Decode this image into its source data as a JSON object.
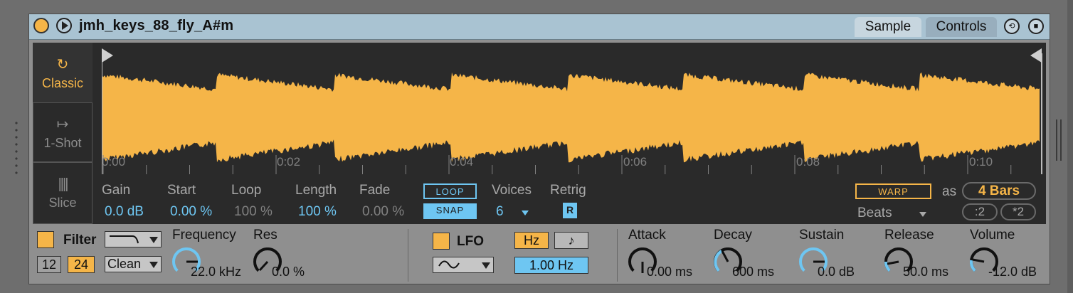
{
  "device": {
    "title": "jmh_keys_88_fly_A#m",
    "tabs": [
      "Sample",
      "Controls"
    ]
  },
  "modes": [
    {
      "label": "Classic",
      "icon": "loop-icon",
      "glyph": "↻"
    },
    {
      "label": "1-Shot",
      "icon": "one-shot-icon",
      "glyph": "↦"
    },
    {
      "label": "Slice",
      "icon": "slice-icon",
      "glyph": "||||"
    }
  ],
  "timeline": [
    "0:00",
    "0:02",
    "0:04",
    "0:06",
    "0:08",
    "0:10"
  ],
  "params": {
    "gain": {
      "label": "Gain",
      "value": "0.0 dB"
    },
    "start": {
      "label": "Start",
      "value": "0.00 %"
    },
    "loop": {
      "label": "Loop",
      "value": "100 %"
    },
    "length": {
      "label": "Length",
      "value": "100 %"
    },
    "fade": {
      "label": "Fade",
      "value": "0.00 %"
    },
    "loop_btn": "LOOP",
    "snap_btn": "SNAP",
    "voices": {
      "label": "Voices",
      "value": "6"
    },
    "retrig": {
      "label": "Retrig",
      "value": "R"
    },
    "warp": "WARP",
    "as_label": "as",
    "bars": "4 Bars",
    "warp_mode": "Beats",
    "div2": ":2",
    "mul2": "*2"
  },
  "filter": {
    "label": "Filter",
    "slope_12": "12",
    "slope_24": "24",
    "circuit": "Clean",
    "frequency": {
      "label": "Frequency",
      "value": "22.0 kHz"
    },
    "res": {
      "label": "Res",
      "value": "0.0 %"
    }
  },
  "lfo": {
    "label": "LFO",
    "hz_btn": "Hz",
    "note_btn": "♪",
    "rate": "1.00 Hz"
  },
  "envelope": {
    "attack": {
      "label": "Attack",
      "value": "0.00 ms"
    },
    "decay": {
      "label": "Decay",
      "value": "600 ms"
    },
    "sustain": {
      "label": "Sustain",
      "value": "0.0 dB"
    },
    "release": {
      "label": "Release",
      "value": "50.0 ms"
    },
    "volume": {
      "label": "Volume",
      "value": "-12.0 dB"
    }
  },
  "colors": {
    "accent": "#f5b548",
    "blue": "#6ec6f2",
    "panel": "#2a2a2a",
    "titlebar": "#a9c3d2"
  }
}
